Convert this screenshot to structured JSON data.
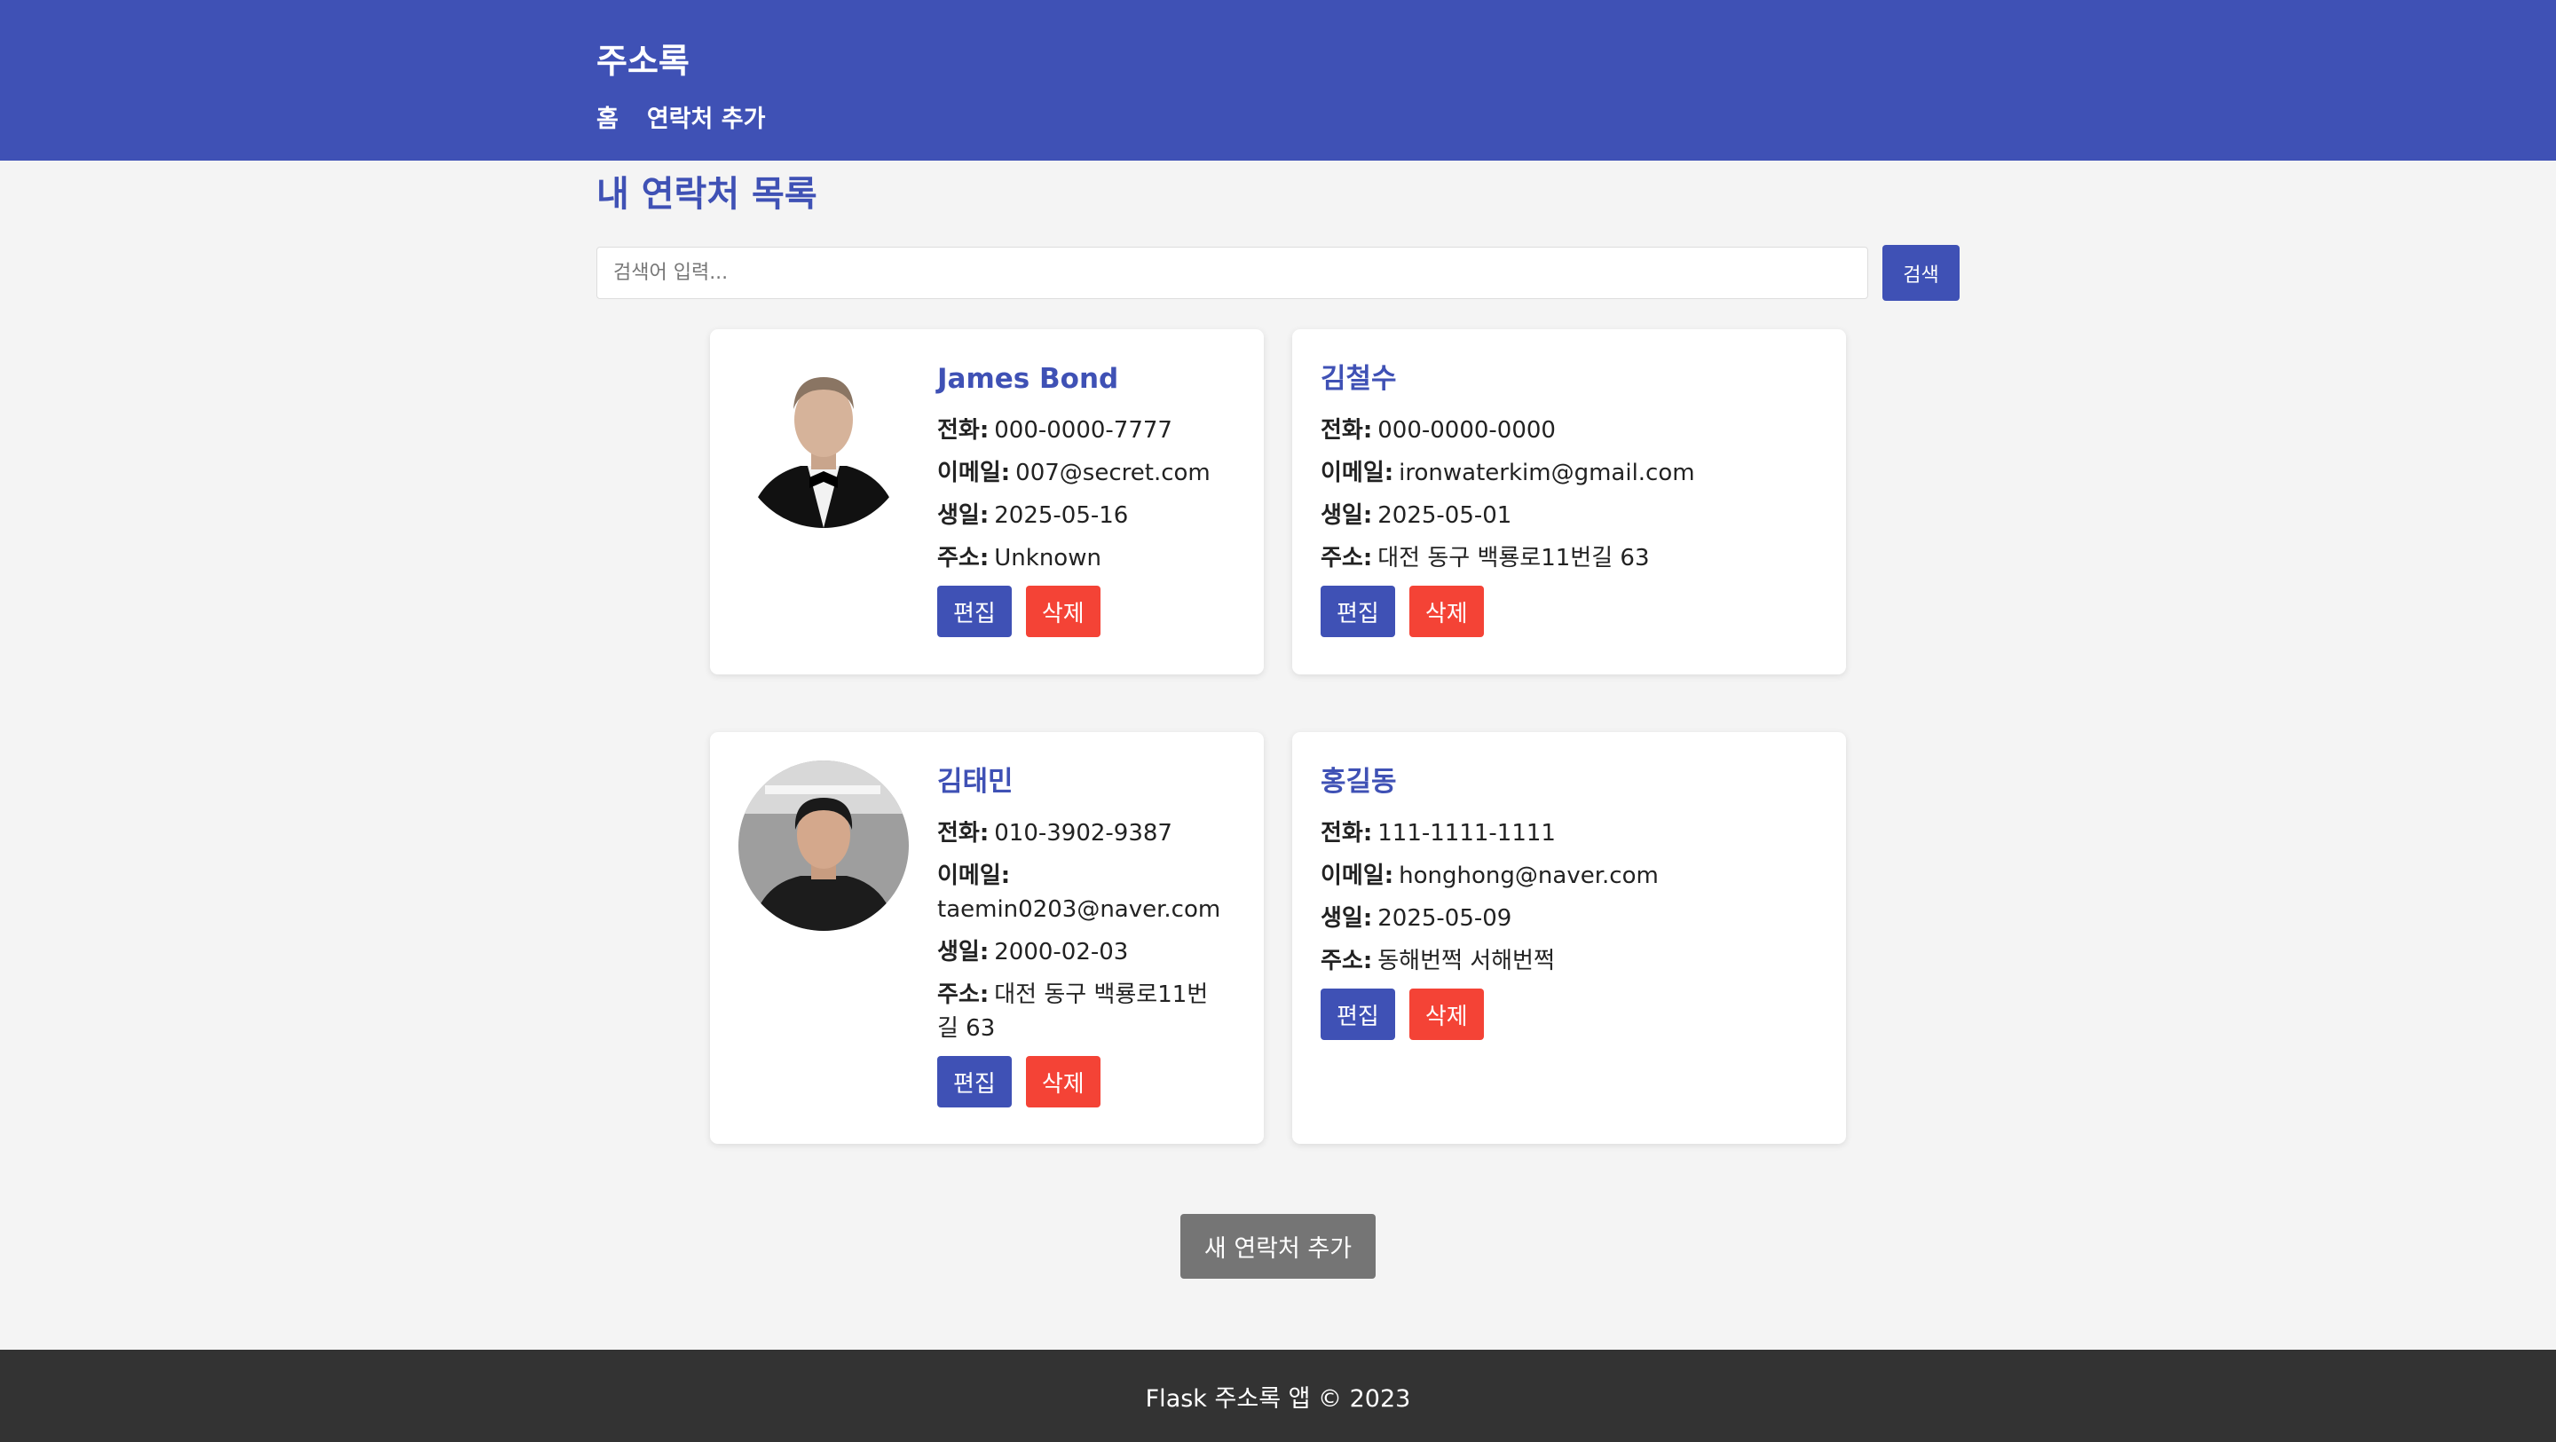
{
  "header": {
    "brand": "주소록",
    "nav": [
      "홈",
      "연락처 추가"
    ]
  },
  "main": {
    "title": "내 연락처 목록",
    "search": {
      "placeholder": "검색어 입력...",
      "value": "",
      "button_label": "검색"
    },
    "labels": {
      "phone": "전화:",
      "email": "이메일:",
      "birthday": "생일:",
      "address": "주소:",
      "edit": "편집",
      "delete": "삭제"
    },
    "contacts": [
      {
        "name": "James Bond",
        "phone": "000-0000-7777",
        "email": "007@secret.com",
        "birthday": "2025-05-16",
        "address": "Unknown",
        "has_photo": true
      },
      {
        "name": "김철수",
        "phone": "000-0000-0000",
        "email": "ironwaterkim@gmail.com",
        "birthday": "2025-05-01",
        "address": "대전 동구 백룡로11번길 63",
        "has_photo": false
      },
      {
        "name": "김태민",
        "phone": "010-3902-9387",
        "email": "taemin0203@naver.com",
        "birthday": "2000-02-03",
        "address": "대전 동구 백룡로11번길 63",
        "has_photo": true
      },
      {
        "name": "홍길동",
        "phone": "111-1111-1111",
        "email": "honghong@naver.com",
        "birthday": "2025-05-09",
        "address": "동해번쩍 서해번쩍",
        "has_photo": false
      }
    ],
    "add_button_label": "새 연락처 추가"
  },
  "footer": {
    "text": "Flask 주소록 앱 © 2023"
  },
  "colors": {
    "primary": "#3f51b5",
    "danger": "#f44336",
    "secondary": "#757575",
    "footer_bg": "#333333",
    "page_bg": "#f4f4f4"
  }
}
